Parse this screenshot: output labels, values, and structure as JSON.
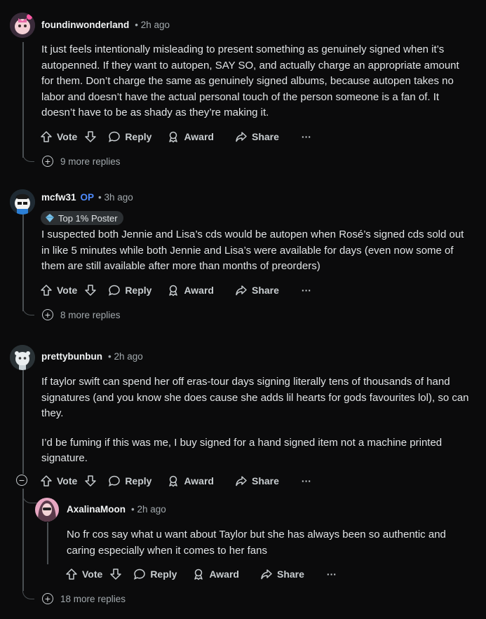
{
  "comments": [
    {
      "username": "foundinwonderland",
      "time": "• 2h ago",
      "body": [
        "It just feels intentionally misleading to present something as genuinely signed when it’s autopenned. If they want to autopen, SAY SO, and actually charge an appropriate amount for them. Don’t charge the same as genuinely signed albums, because autopen takes no labor and doesn’t have the actual personal touch of the person someone is a fan of. It doesn’t have to be as shady as they’re making it."
      ],
      "more_replies": "9 more replies"
    },
    {
      "username": "mcfw31",
      "op": "OP",
      "time": "• 3h ago",
      "badge": "Top 1% Poster",
      "body": [
        "I suspected both Jennie and Lisa’s cds would be autopen when Rosé’s signed cds sold out in like 5 minutes while both Jennie and Lisa’s were available for days (even now some of them are still available after more than months of preorders)"
      ],
      "more_replies": "8 more replies"
    },
    {
      "username": "prettybunbun",
      "time": "• 2h ago",
      "body": [
        "If taylor swift can spend her off eras-tour days signing literally tens of thousands of hand signatures (and you know she does cause she adds lil hearts for gods favourites lol), so can they.",
        "I’d be fuming if this was me, I buy signed for a hand signed item not a machine printed signature."
      ]
    },
    {
      "username": "AxalinaMoon",
      "time": "• 2h ago",
      "body": [
        "No fr cos say what u want about Taylor but she has always been so authentic and caring especially when it comes to her fans"
      ],
      "more_replies": "18 more replies"
    }
  ],
  "actions": {
    "vote": "Vote",
    "reply": "Reply",
    "award": "Award",
    "share": "Share",
    "more": "···"
  },
  "colors": {
    "background": "#0b0b0c",
    "op": "#4f8cff",
    "thread_line": "#4a4f52"
  },
  "icons": [
    "upvote-icon",
    "downvote-icon",
    "reply-icon",
    "award-icon",
    "share-icon",
    "overflow-icon",
    "plus-circle-icon",
    "minus-circle-icon"
  ]
}
